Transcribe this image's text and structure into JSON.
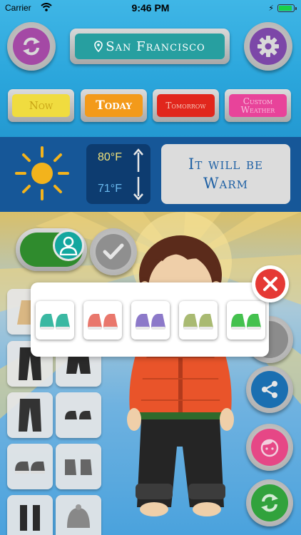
{
  "status_bar": {
    "carrier": "Carrier",
    "time": "9:46 PM"
  },
  "location": {
    "city": "San Francisco"
  },
  "day_tabs": [
    {
      "label": "Now",
      "color": "#f0dc3f",
      "text_color": "#c9a416"
    },
    {
      "label": "Today",
      "color": "#f39a1a",
      "text_color": "#ffffff"
    },
    {
      "label": "Tomorrow",
      "color": "#e1261c",
      "text_color": "#f7c6b9"
    },
    {
      "label": "Custom Weather",
      "color": "#e8439a",
      "text_color": "#f7c0de"
    }
  ],
  "weather": {
    "high": "80°F",
    "low": "71°F",
    "message": "It will be Warm"
  },
  "shoe_picker": {
    "options": [
      {
        "name": "teal-shoes",
        "color": "#3ab8a2"
      },
      {
        "name": "coral-shoes",
        "color": "#e9776c"
      },
      {
        "name": "purple-shoes",
        "color": "#8c79c9"
      },
      {
        "name": "olive-shoes",
        "color": "#a9ba72"
      },
      {
        "name": "green-shoes",
        "color": "#44c14e"
      }
    ]
  },
  "colors": {
    "refresh_button": "#a449a5",
    "settings_button": "#7c47a8",
    "share_button": "#1a6fb1",
    "face_button": "#e64786",
    "regenerate_button": "#31a23c",
    "close_button": "#e53935"
  }
}
